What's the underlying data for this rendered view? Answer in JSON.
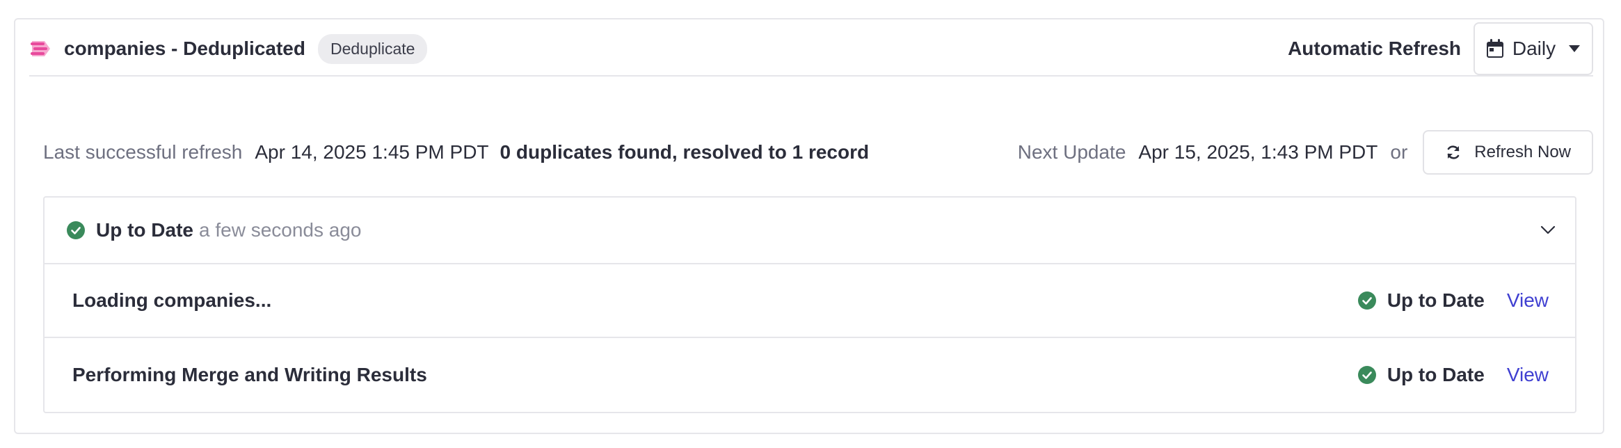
{
  "header": {
    "title": "companies - Deduplicated",
    "badge": "Deduplicate",
    "auto_refresh_label": "Automatic Refresh",
    "schedule_value": "Daily",
    "brand_color": "#e84a9c"
  },
  "info": {
    "last_refresh_label": "Last successful refresh",
    "last_refresh_value": "Apr 14, 2025 1:45 PM PDT",
    "result_summary": "0 duplicates found, resolved to 1 record",
    "next_update_label": "Next Update",
    "next_update_value": "Apr 15, 2025, 1:43 PM PDT",
    "or_text": "or",
    "refresh_button": "Refresh Now"
  },
  "status": {
    "summary_status": "Up to Date",
    "summary_time": "a few seconds ago",
    "success_color": "#3a8a5b",
    "link_color": "#3f3fd1",
    "steps": [
      {
        "label": "Loading companies...",
        "status": "Up to Date",
        "action": "View"
      },
      {
        "label": "Performing Merge and Writing Results",
        "status": "Up to Date",
        "action": "View"
      }
    ]
  },
  "icons": [
    "dedupe-brand-icon",
    "calendar-icon",
    "caret-down-icon",
    "refresh-icon",
    "check-circle-icon",
    "chevron-down-icon"
  ]
}
